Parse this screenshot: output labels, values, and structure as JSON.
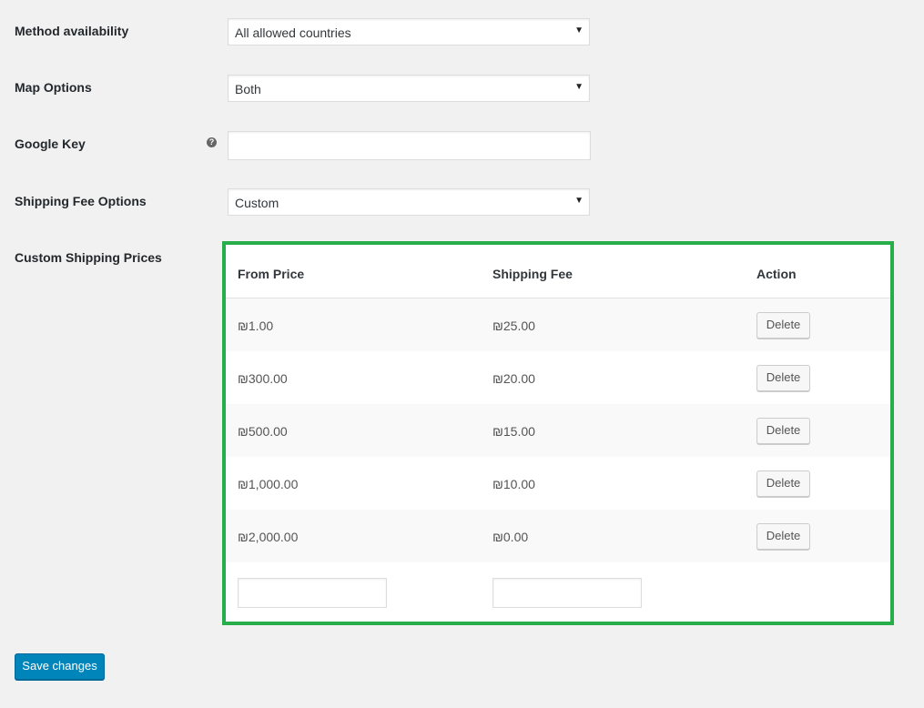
{
  "fields": {
    "method_availability": {
      "label": "Method availability",
      "value": "All allowed countries"
    },
    "map_options": {
      "label": "Map Options",
      "value": "Both"
    },
    "google_key": {
      "label": "Google Key",
      "value": "",
      "help_icon": "help-icon"
    },
    "shipping_fee_options": {
      "label": "Shipping Fee Options",
      "value": "Custom"
    },
    "custom_shipping_prices": {
      "label": "Custom Shipping Prices"
    }
  },
  "price_table": {
    "headers": [
      "From Price",
      "Shipping Fee",
      "Action"
    ],
    "rows": [
      {
        "from": "₪1.00",
        "fee": "₪25.00",
        "action": "Delete"
      },
      {
        "from": "₪300.00",
        "fee": "₪20.00",
        "action": "Delete"
      },
      {
        "from": "₪500.00",
        "fee": "₪15.00",
        "action": "Delete"
      },
      {
        "from": "₪1,000.00",
        "fee": "₪10.00",
        "action": "Delete"
      },
      {
        "from": "₪2,000.00",
        "fee": "₪0.00",
        "action": "Delete"
      }
    ],
    "new_row": {
      "from": "",
      "fee": ""
    },
    "highlight_color": "#27ae4a"
  },
  "save_button": {
    "label": "Save changes",
    "color": "#0085ba"
  }
}
